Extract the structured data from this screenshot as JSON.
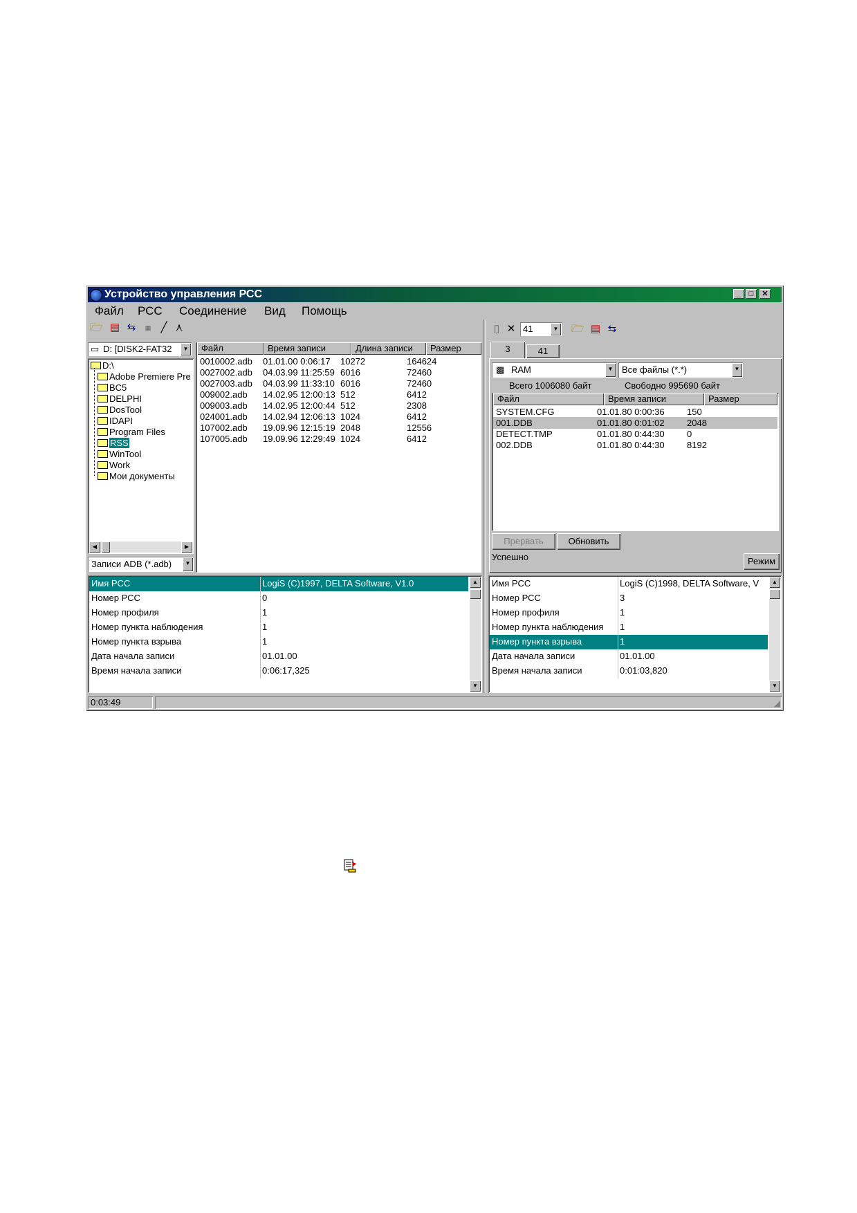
{
  "window": {
    "title": "Устройство управления РСС"
  },
  "menu": [
    "Файл",
    "РСС",
    "Соединение",
    "Вид",
    "Помощь"
  ],
  "left": {
    "drive": "D: [DISK2-FAT32",
    "tree": [
      "D:\\",
      "Adobe Premiere Pre",
      "BC5",
      "DELPHI",
      "DosTool",
      "IDAPI",
      "Program Files",
      "RSS",
      "WinTool",
      "Work",
      "Мои документы"
    ],
    "filter": "Записи ADB (*.adb)",
    "file_headers": [
      "Файл",
      "Время записи",
      "Длина записи",
      "Размер"
    ],
    "files": [
      [
        "0010002.adb",
        "01.01.00 0:06:17",
        "10272",
        "164624"
      ],
      [
        "0027002.adb",
        "04.03.99 11:25:59",
        "6016",
        "72460"
      ],
      [
        "0027003.adb",
        "04.03.99 11:33:10",
        "6016",
        "72460"
      ],
      [
        "009002.adb",
        "14.02.95 12:00:13",
        "512",
        "6412"
      ],
      [
        "009003.adb",
        "14.02.95 12:00:44",
        "512",
        "2308"
      ],
      [
        "024001.adb",
        "14.02.94 12:06:13",
        "1024",
        "6412"
      ],
      [
        "107002.adb",
        "19.09.96 12:15:19",
        "2048",
        "12556"
      ],
      [
        "107005.adb",
        "19.09.96 12:29:49",
        "1024",
        "6412"
      ]
    ],
    "props": [
      [
        "Имя РСС",
        "LogiS (C)1997, DELTA Software, V1.0"
      ],
      [
        "Номер РСС",
        "0"
      ],
      [
        "Номер профиля",
        "1"
      ],
      [
        "Номер пункта наблюдения",
        "1"
      ],
      [
        "Номер пункта взрыва",
        "1"
      ],
      [
        "Дата начала записи",
        "01.01.00"
      ],
      [
        "Время начала записи",
        "0:06:17,325"
      ]
    ]
  },
  "right": {
    "device_combo": "41",
    "tabs": [
      "3",
      "41"
    ],
    "memory": "RAM",
    "file_filter": "Все файлы (*.*)",
    "total": "Всего 1006080 байт",
    "free": "Свободно 995690 байт",
    "file_headers": [
      "Файл",
      "Время записи",
      "Размер"
    ],
    "files": [
      [
        "SYSTEM.CFG",
        "01.01.80 0:00:36",
        "150"
      ],
      [
        "001.DDB",
        "01.01.80 0:01:02",
        "2048"
      ],
      [
        "DETECT.TMP",
        "01.01.80 0:44:30",
        "0"
      ],
      [
        "002.DDB",
        "01.01.80 0:44:30",
        "8192"
      ]
    ],
    "btn_abort": "Прервать",
    "btn_refresh": "Обновить",
    "status": "Успешно",
    "btn_mode": "Режим",
    "props": [
      [
        "Имя РСС",
        "LogiS (C)1998, DELTA Software, V"
      ],
      [
        "Номер РСС",
        "3"
      ],
      [
        "Номер профиля",
        "1"
      ],
      [
        "Номер пункта наблюдения",
        "1"
      ],
      [
        "Номер пункта взрыва",
        "1"
      ],
      [
        "Дата начала записи",
        "01.01.00"
      ],
      [
        "Время начала записи",
        "0:01:03,820"
      ]
    ]
  },
  "statusbar": {
    "time": "0:03:49"
  }
}
